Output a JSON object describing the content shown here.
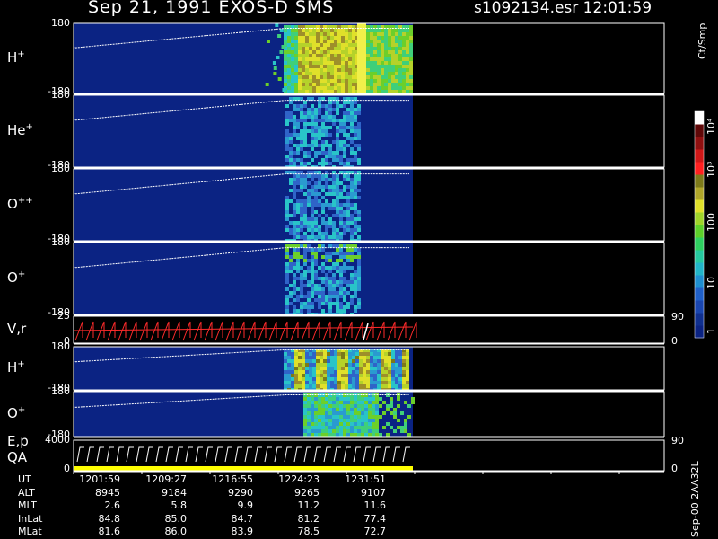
{
  "header": {
    "title": "Sep 21, 1991    EXOS-D SMS",
    "file_time": "s1092134.esr   12:01:59"
  },
  "colors": {
    "background": "#000000",
    "axis": "#ffffff",
    "no_data": "#0b2383",
    "velocity_trace": "#ff2b2b",
    "qa_bar": "#ffff00"
  },
  "chart_data": {
    "type": "heatmap",
    "x": [
      "1201:59",
      "1209:27",
      "1216:55",
      "1224:23",
      "1231:51"
    ],
    "colorbar": {
      "title": "Ct/Smp",
      "ticks": [
        "1",
        "10",
        "100",
        "10³",
        "10⁴"
      ],
      "scale": "log",
      "range": [
        1,
        10000
      ]
    },
    "panels": [
      {
        "label_base": "H",
        "label_sup": "+",
        "ymax": "180",
        "ymin": "-180"
      },
      {
        "label_base": "He",
        "label_sup": "+",
        "ymax": "180",
        "ymin": "-180"
      },
      {
        "label_base": "O",
        "label_sup": "++",
        "ymax": "180",
        "ymin": "-180"
      },
      {
        "label_base": "O",
        "label_sup": "+",
        "ymax": "180",
        "ymin": "-180"
      },
      {
        "label_base": "V,r",
        "label_sup": "",
        "ymax": "25",
        "ymin": "0",
        "rmax": "90",
        "rmin": "0"
      },
      {
        "label_base": "H",
        "label_sup": "+",
        "ymax": "180",
        "ymin": "-180"
      },
      {
        "label_base": "O",
        "label_sup": "+",
        "ymax": "180",
        "ymin": "-180"
      },
      {
        "label_base": "E,p",
        "label2": "QA",
        "ymax": "4000",
        "ymin": "0",
        "rmax": "90",
        "rmin": "0"
      }
    ]
  },
  "ephemeris": {
    "rows": [
      {
        "label": "UT",
        "values": [
          "1201:59",
          "1209:27",
          "1216:55",
          "1224:23",
          "1231:51"
        ]
      },
      {
        "label": "ALT",
        "values": [
          "8945",
          "9184",
          "9290",
          "9265",
          "9107"
        ]
      },
      {
        "label": "MLT",
        "values": [
          "2.6",
          "5.8",
          "9.9",
          "11.2",
          "11.6"
        ]
      },
      {
        "label": "InLat",
        "values": [
          "84.8",
          "85.0",
          "84.7",
          "81.2",
          "77.4"
        ]
      },
      {
        "label": "MLat",
        "values": [
          "81.6",
          "86.0",
          "83.9",
          "78.5",
          "72.7"
        ]
      }
    ]
  },
  "footer": {
    "label": "Sep-00  2AA32L"
  }
}
